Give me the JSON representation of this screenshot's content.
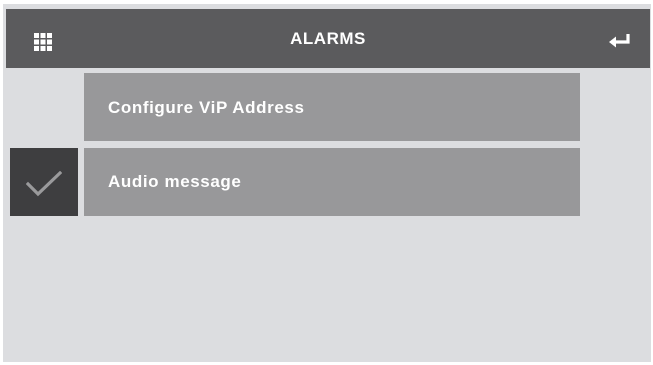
{
  "header": {
    "title": "ALARMS",
    "menu_icon": "grid-icon",
    "back_icon": "return-arrow-icon"
  },
  "items": [
    {
      "label": "Configure ViP Address",
      "checked": false
    },
    {
      "label": "Audio message",
      "checked": true
    }
  ],
  "colors": {
    "background": "#dcdde0",
    "header": "#5b5b5d",
    "item": "#98989a",
    "check_box": "#3e3e40",
    "text": "#ffffff",
    "check_mark": "#9a9a9c"
  }
}
